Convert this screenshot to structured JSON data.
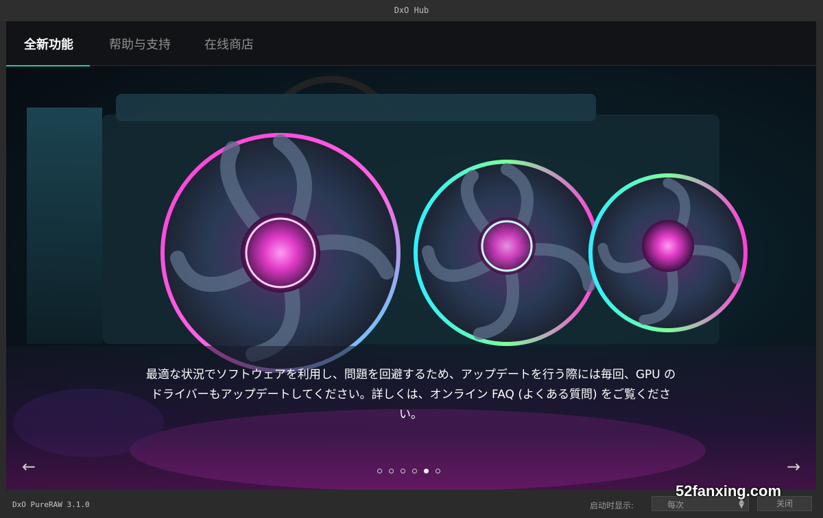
{
  "window": {
    "title": "DxO Hub"
  },
  "tabs": [
    {
      "label": "全新功能",
      "active": true
    },
    {
      "label": "帮助与支持",
      "active": false
    },
    {
      "label": "在线商店",
      "active": false
    }
  ],
  "hero": {
    "image_icon": "gpu-fans-illustration",
    "caption": "最適な状況でソフトウェアを利用し、問題を回避するため、アップデートを行う際には毎回、GPU のドライバーもアップデートしてください。詳しくは、オンライン FAQ (よくある質問) をご覧ください。",
    "prev_icon": "arrow-left-icon",
    "next_icon": "arrow-right-icon",
    "prev_glyph": "←",
    "next_glyph": "→",
    "slide_count": 6,
    "active_slide": 5
  },
  "footer": {
    "version": "DxO PureRAW 3.1.0",
    "startup_label": "启动时显示:",
    "startup_value": "每次",
    "close_label": "关闭"
  },
  "watermark": "52fanxing.com",
  "colors": {
    "accent": "#1dcfa8",
    "neon_pink": "#ff3fd8",
    "neon_cyan": "#2ef0ff"
  }
}
